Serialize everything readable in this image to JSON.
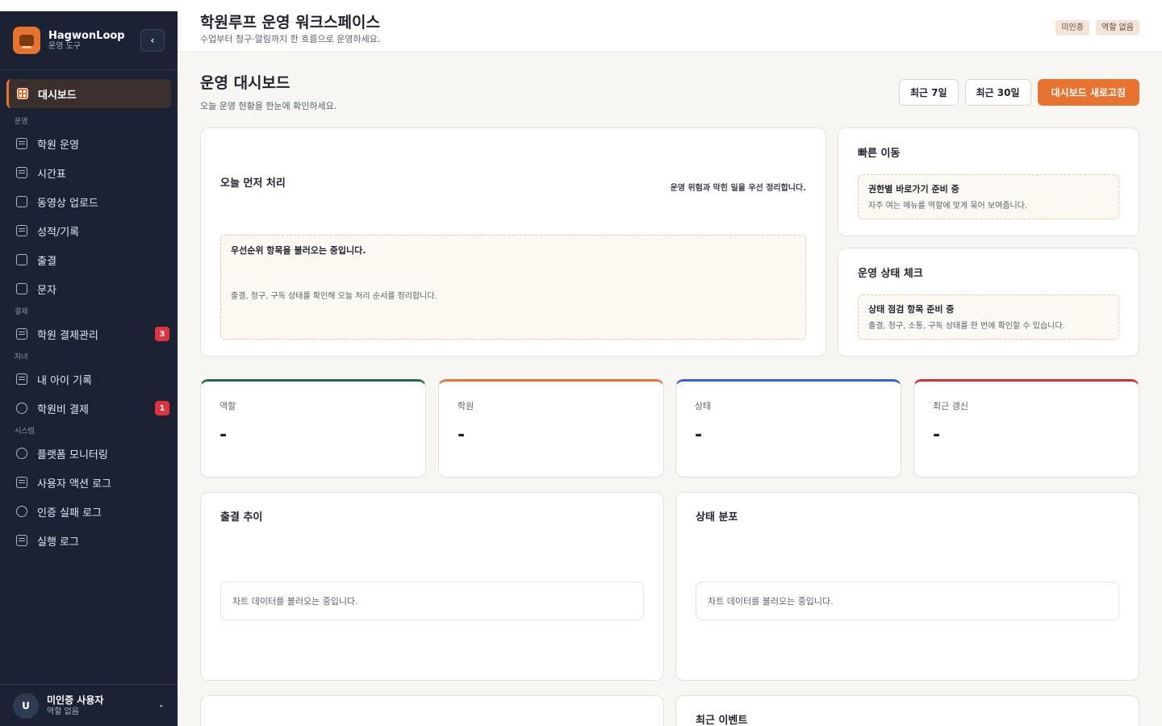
{
  "brand": {
    "name": "HagwonLoop",
    "subtitle": "운영 도구",
    "collapse_icon": "chevron-left-icon"
  },
  "nav": {
    "dashboard": "대시보드",
    "section_ops": "운영",
    "academy_ops": "학원 운영",
    "timetable": "시간표",
    "video_upload": "동영상 업로드",
    "grades": "성적/기록",
    "attendance": "출결",
    "sms": "문자",
    "section_payment": "결제",
    "payment_mgmt": "학원 결제관리",
    "payment_mgmt_badge": "3",
    "section_child": "자녀",
    "child_record": "내 아이 기록",
    "tuition": "학원비 결제",
    "tuition_badge": "1",
    "section_system": "시스템",
    "platform_monitoring": "플랫폼 모니터링",
    "user_action_log": "사용자 액션 로그",
    "auth_fail_log": "인증 실패 로그",
    "exec_log": "실행 로그"
  },
  "user": {
    "avatar": "U",
    "name": "미인증 사용자",
    "role": "역할 없음"
  },
  "header": {
    "title": "학원루프 운영 워크스페이스",
    "subtitle": "수업부터 청구·알림까지 한 흐름으로 운영하세요.",
    "badge_auth": "미인증",
    "badge_role": "역할 없음"
  },
  "page": {
    "title": "운영 대시보드",
    "subtitle": "오늘 운영 현황을 한눈에 확인하세요.",
    "btn_7d": "최근 7일",
    "btn_30d": "최근 30일",
    "btn_refresh": "대시보드 새로고침"
  },
  "today_card": {
    "title": "오늘 먼저 처리",
    "note": "운영 위험과 막힌 일을 우선 정리합니다.",
    "box_title": "우선순위 항목을 불러오는 중입니다.",
    "box_desc": "출결, 청구, 구독 상태를 확인해 오늘 처리 순서를 정리합니다."
  },
  "quick_card": {
    "title": "빠른 이동",
    "box_title": "권한별 바로가기 준비 중",
    "box_desc": "자주 여는 메뉴를 역할에 맞게 묶어 보여줍니다."
  },
  "status_card": {
    "title": "운영 상태 체크",
    "box_title": "상태 점검 항목 준비 중",
    "box_desc": "출결, 청구, 소통, 구독 상태를 한 번에 확인할 수 있습니다."
  },
  "kpis": [
    {
      "label": "역할",
      "value": "-",
      "color": "#1f6b4a"
    },
    {
      "label": "학원",
      "value": "-",
      "color": "#e8732e"
    },
    {
      "label": "상태",
      "value": "-",
      "color": "#2f64d8"
    },
    {
      "label": "최근 갱신",
      "value": "-",
      "color": "#d0343b"
    }
  ],
  "attendance_chart": {
    "title": "출결 추이",
    "loading": "차트 데이터를 불러오는 중입니다."
  },
  "status_chart": {
    "title": "상태 분포",
    "loading": "차트 데이터를 불러오는 중입니다."
  },
  "recent_events": {
    "title": "최근 이벤트"
  }
}
